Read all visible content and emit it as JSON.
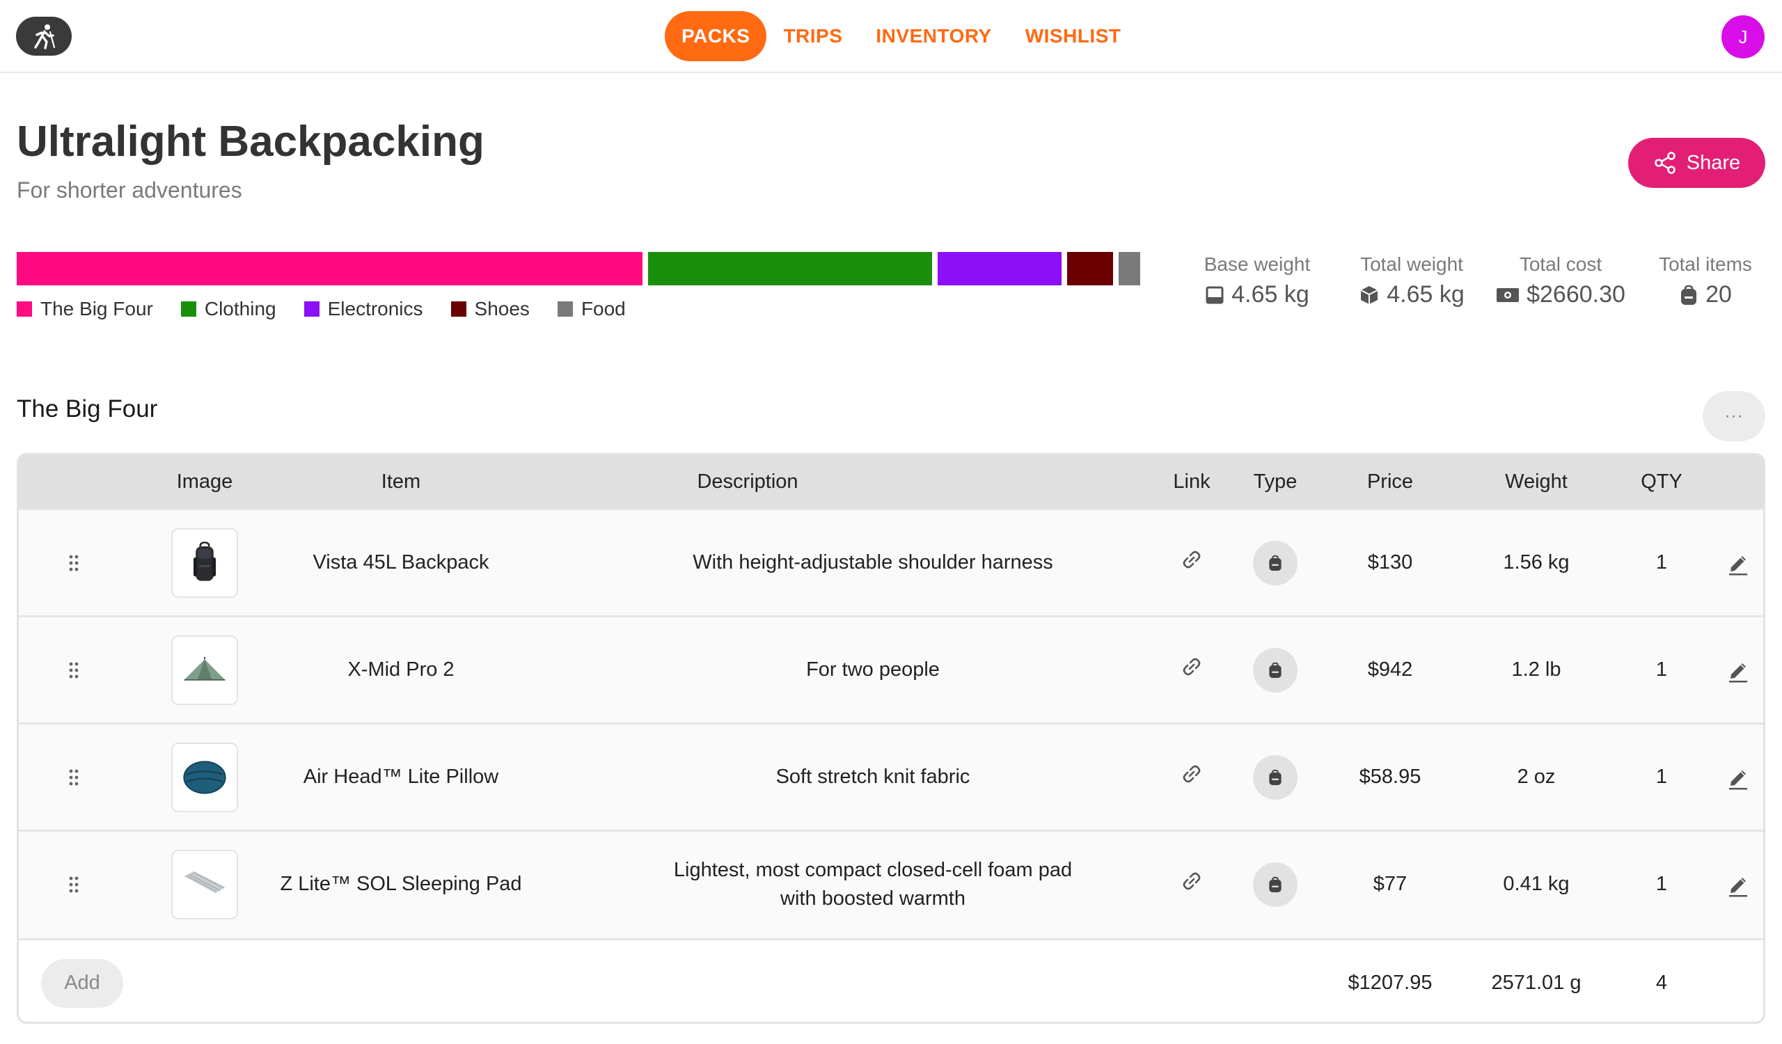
{
  "nav": {
    "logo_icon": "hiker-icon",
    "tabs": [
      {
        "label": "PACKS",
        "active": true
      },
      {
        "label": "TRIPS",
        "active": false
      },
      {
        "label": "INVENTORY",
        "active": false
      },
      {
        "label": "WISHLIST",
        "active": false
      }
    ],
    "avatar_initial": "J"
  },
  "pack": {
    "title": "Ultralight Backpacking",
    "subtitle": "For shorter adventures",
    "share_label": "Share"
  },
  "weight_breakdown": [
    {
      "label": "The Big Four",
      "color": "#ff0a80",
      "fraction": 0.555
    },
    {
      "label": "Clothing",
      "color": "#1a8f0d",
      "fraction": 0.252
    },
    {
      "label": "Electronics",
      "color": "#8c10f5",
      "fraction": 0.11
    },
    {
      "label": "Shoes",
      "color": "#6b0000",
      "fraction": 0.041
    },
    {
      "label": "Food",
      "color": "#7a7a7a",
      "fraction": 0.019
    }
  ],
  "stats": {
    "base_weight": {
      "label": "Base weight",
      "value": "4.65 kg",
      "icon": "scale-icon"
    },
    "total_weight": {
      "label": "Total weight",
      "value": "4.65 kg",
      "icon": "package-icon"
    },
    "total_cost": {
      "label": "Total cost",
      "value": "$2660.30",
      "icon": "money-icon"
    },
    "total_items": {
      "label": "Total items",
      "value": "20",
      "icon": "backpack-icon"
    }
  },
  "category": {
    "title": "The Big Four",
    "more_label": "···",
    "columns": {
      "image": "Image",
      "item": "Item",
      "description": "Description",
      "link": "Link",
      "type": "Type",
      "price": "Price",
      "weight": "Weight",
      "qty": "QTY"
    },
    "items": [
      {
        "name": "Vista 45L Backpack",
        "description": "With height-adjustable shoulder harness",
        "price": "$130",
        "weight": "1.56 kg",
        "qty": "1",
        "image": "backpack"
      },
      {
        "name": "X-Mid Pro 2",
        "description": "For two people",
        "price": "$942",
        "weight": "1.2 lb",
        "qty": "1",
        "image": "tent"
      },
      {
        "name": "Air Head™ Lite Pillow",
        "description": "Soft stretch knit fabric",
        "price": "$58.95",
        "weight": "2 oz",
        "qty": "1",
        "image": "pillow"
      },
      {
        "name": "Z Lite™ SOL Sleeping Pad",
        "description": "Lightest, most compact closed-cell foam pad with boosted warmth",
        "price": "$77",
        "weight": "0.41 kg",
        "qty": "1",
        "image": "pad"
      }
    ],
    "add_label": "Add",
    "totals": {
      "price": "$1207.95",
      "weight": "2571.01 g",
      "qty": "4"
    }
  }
}
